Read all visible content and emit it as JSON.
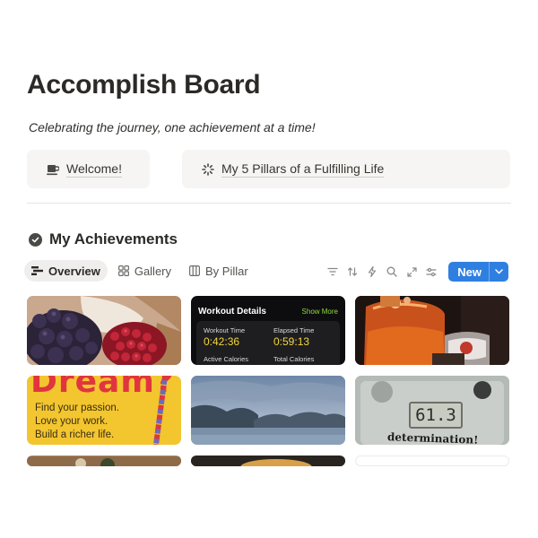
{
  "page": {
    "title": "Accomplish Board",
    "subtitle": "Celebrating the journey, one achievement at a time!"
  },
  "callouts": [
    {
      "icon": "coffee-cup-icon",
      "label": "Welcome!"
    },
    {
      "icon": "loading-spinner-icon",
      "label": "My 5 Pillars of a Fulfilling Life"
    }
  ],
  "section": {
    "icon": "check-circle-icon",
    "title": "My Achievements"
  },
  "tabs": [
    {
      "label": "Overview",
      "icon": "table-icon",
      "active": true
    },
    {
      "label": "Gallery",
      "icon": "grid-icon",
      "active": false
    },
    {
      "label": "By Pillar",
      "icon": "columns-icon",
      "active": false
    }
  ],
  "toolbar": {
    "icons": [
      "filter-icon",
      "sort-icon",
      "lightning-icon",
      "search-icon",
      "expand-icon",
      "settings-sliders-icon"
    ],
    "new_label": "New",
    "accent": "#2f7fe1"
  },
  "cards": {
    "workout": {
      "title": "Workout Details",
      "more": "Show More",
      "workout_time_label": "Workout Time",
      "workout_time": "0:42:36",
      "elapsed_time_label": "Elapsed Time",
      "elapsed_time": "0:59:13",
      "active_cal_label": "Active Calories",
      "total_cal_label": "Total Calories"
    },
    "dream": {
      "big": "Dream?",
      "lines": [
        "Find your passion.",
        "Love your work.",
        "Build a richer life."
      ]
    },
    "scale": {
      "display": "61.3",
      "word": "determination!"
    }
  }
}
